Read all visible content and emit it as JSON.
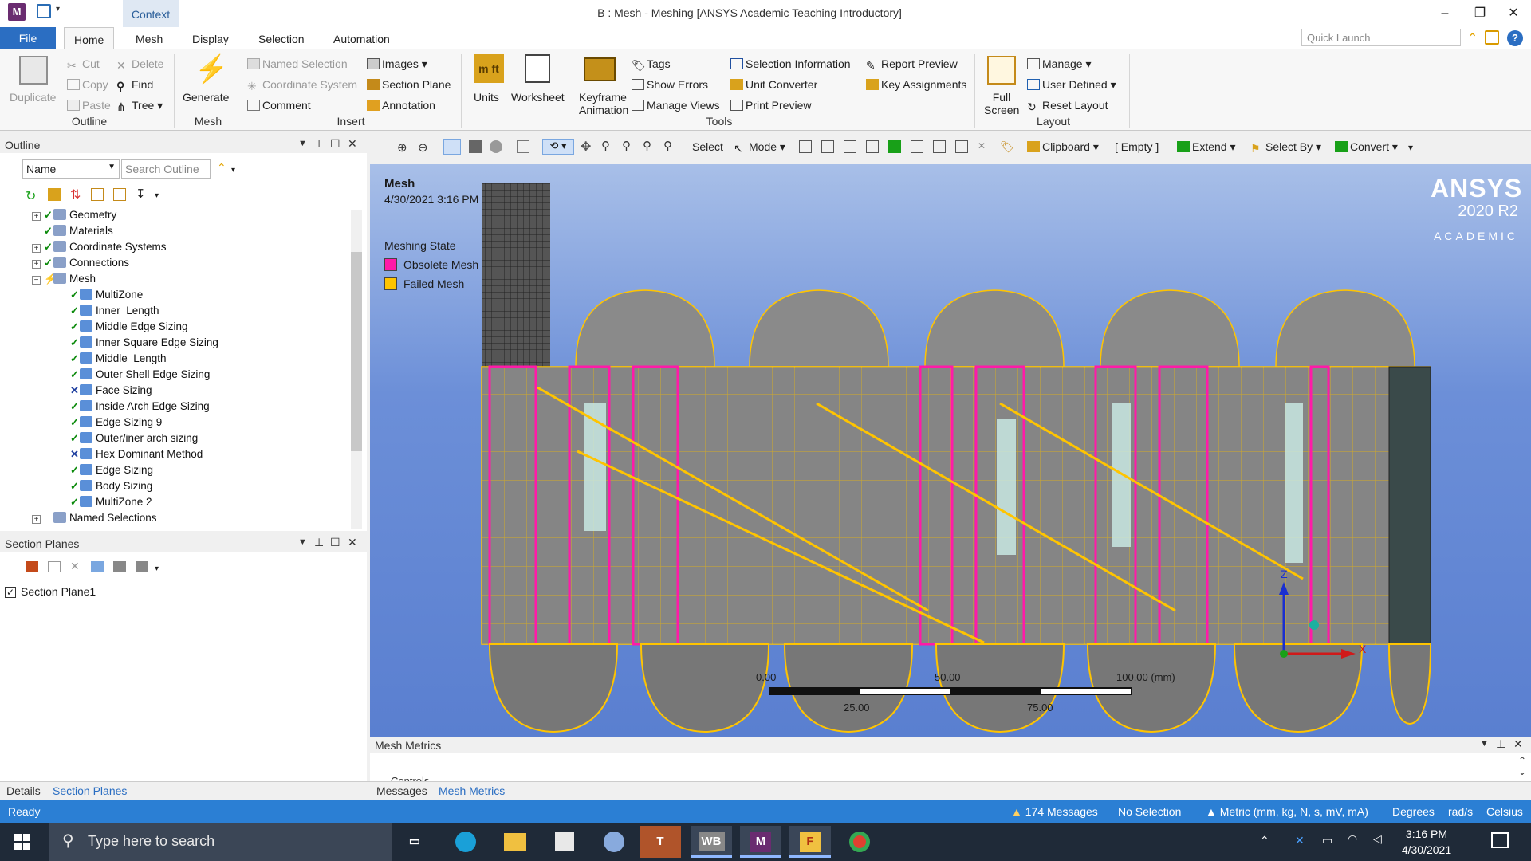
{
  "titlebar": {
    "app_icon": "M",
    "context_tab": "Context",
    "title": "B : Mesh - Meshing [ANSYS Academic Teaching Introductory]",
    "minimize": "–",
    "restore": "❐",
    "close": "✕"
  },
  "tabs": [
    "File",
    "Home",
    "Mesh",
    "Display",
    "Selection",
    "Automation"
  ],
  "quick_launch_placeholder": "Quick Launch",
  "ribbon": {
    "outline": {
      "label": "Outline",
      "duplicate": "Duplicate",
      "cut": "Cut",
      "copy": "Copy",
      "paste": "Paste",
      "delete": "Delete",
      "find": "Find",
      "tree": "Tree"
    },
    "mesh": {
      "label": "Mesh",
      "generate": "Generate"
    },
    "insert": {
      "label": "Insert",
      "named_selection": "Named Selection",
      "coordinate_system": "Coordinate System",
      "comment": "Comment",
      "images": "Images",
      "section_plane": "Section Plane",
      "annotation": "Annotation"
    },
    "tools": {
      "label": "Tools",
      "units": "Units",
      "worksheet": "Worksheet",
      "keyframe_animation_1": "Keyframe",
      "keyframe_animation_2": "Animation",
      "tags": "Tags",
      "show_errors": "Show Errors",
      "manage_views": "Manage Views",
      "selection_information": "Selection Information",
      "unit_converter": "Unit Converter",
      "print_preview": "Print Preview",
      "report_preview": "Report Preview",
      "key_assignments": "Key Assignments"
    },
    "layout": {
      "label": "Layout",
      "full_screen_1": "Full",
      "full_screen_2": "Screen",
      "manage": "Manage",
      "user_defined": "User Defined",
      "reset_layout": "Reset Layout"
    }
  },
  "graphics_toolbar": {
    "select": "Select",
    "mode": "Mode",
    "clipboard": "Clipboard",
    "empty": "[ Empty ]",
    "extend": "Extend",
    "select_by": "Select By",
    "convert": "Convert"
  },
  "outline_panel": {
    "title": "Outline",
    "name_filter": "Name",
    "search_placeholder": "Search Outline",
    "tree": [
      {
        "label": "Geometry",
        "level": 1,
        "state": "check",
        "expander": "+"
      },
      {
        "label": "Materials",
        "level": 1,
        "state": "check",
        "expander": ""
      },
      {
        "label": "Coordinate Systems",
        "level": 1,
        "state": "check",
        "expander": "+"
      },
      {
        "label": "Connections",
        "level": 1,
        "state": "check",
        "expander": "+"
      },
      {
        "label": "Mesh",
        "level": 1,
        "state": "lightning",
        "expander": "−"
      },
      {
        "label": "MultiZone",
        "level": 2,
        "state": "check",
        "expander": ""
      },
      {
        "label": "Inner_Length",
        "level": 2,
        "state": "check",
        "expander": ""
      },
      {
        "label": "Middle Edge Sizing",
        "level": 2,
        "state": "check",
        "expander": ""
      },
      {
        "label": "Inner Square Edge Sizing",
        "level": 2,
        "state": "check",
        "expander": ""
      },
      {
        "label": "Middle_Length",
        "level": 2,
        "state": "check",
        "expander": ""
      },
      {
        "label": "Outer Shell Edge Sizing",
        "level": 2,
        "state": "check",
        "expander": ""
      },
      {
        "label": "Face Sizing",
        "level": 2,
        "state": "x",
        "expander": ""
      },
      {
        "label": "Inside Arch Edge Sizing",
        "level": 2,
        "state": "check",
        "expander": ""
      },
      {
        "label": "Edge Sizing 9",
        "level": 2,
        "state": "check",
        "expander": ""
      },
      {
        "label": "Outer/iner arch sizing",
        "level": 2,
        "state": "check",
        "expander": ""
      },
      {
        "label": "Hex Dominant Method",
        "level": 2,
        "state": "x",
        "expander": ""
      },
      {
        "label": "Edge Sizing",
        "level": 2,
        "state": "check",
        "expander": ""
      },
      {
        "label": "Body Sizing",
        "level": 2,
        "state": "check",
        "expander": ""
      },
      {
        "label": "MultiZone 2",
        "level": 2,
        "state": "check",
        "expander": ""
      },
      {
        "label": "Named Selections",
        "level": 1,
        "state": "",
        "expander": "+"
      }
    ]
  },
  "section_planes_panel": {
    "title": "Section Planes",
    "items": [
      {
        "label": "Section Plane1",
        "checked": true
      }
    ]
  },
  "viewport": {
    "title": "Mesh",
    "date": "4/30/2021 3:16 PM",
    "legend_title": "Meshing State",
    "legend": [
      {
        "label": "Obsolete Mesh",
        "color": "#ff1aa8"
      },
      {
        "label": "Failed Mesh",
        "color": "#ffc400"
      }
    ],
    "brand": "ANSYS",
    "version": "2020 R2",
    "edition": "ACADEMIC",
    "scale": {
      "t0": "0.00",
      "t50": "50.00",
      "t100": "100.00 (mm)",
      "t25": "25.00",
      "t75": "75.00"
    },
    "axis_z": "Z",
    "axis_x": "X"
  },
  "mesh_metrics_panel": {
    "title": "Mesh Metrics",
    "controls": "Controls"
  },
  "bottom_tabs": {
    "details": "Details",
    "section_planes": "Section Planes",
    "messages": "Messages",
    "mesh_metrics": "Mesh Metrics"
  },
  "status": {
    "ready": "Ready",
    "messages": "174 Messages",
    "selection": "No Selection",
    "units": "Metric (mm, kg, N, s, mV, mA)",
    "degrees": "Degrees",
    "rads": "rad/s",
    "temp": "Celsius"
  },
  "taskbar": {
    "search_placeholder": "Type here to search",
    "time": "3:16 PM",
    "date": "4/30/2021",
    "apps": [
      "task-view",
      "edge",
      "file-explorer",
      "store",
      "app-blue",
      "teams",
      "workbench",
      "meshing",
      "fluent",
      "chrome"
    ],
    "app_labels": {
      "teams": "T",
      "workbench": "WB",
      "meshing": "M",
      "fluent": "F"
    }
  },
  "colors": {
    "accent": "#2b7fd4",
    "mesh_edge": "#ffc400",
    "obsolete": "#ff1aa8"
  }
}
